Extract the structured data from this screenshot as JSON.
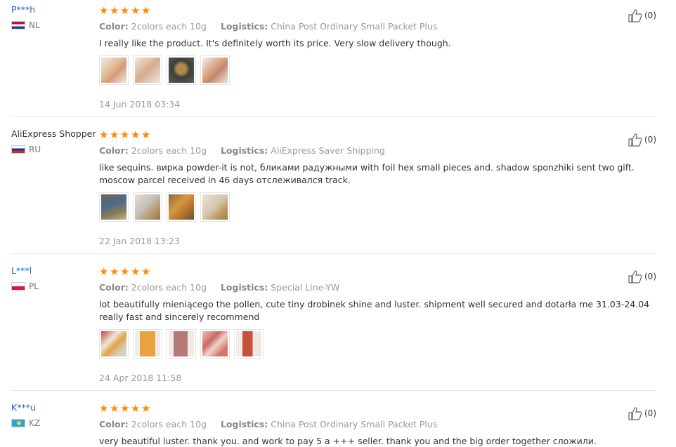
{
  "labels": {
    "color": "Color:",
    "logistics": "Logistics:"
  },
  "reviews": [
    {
      "user": "P***h",
      "country": "NL",
      "color": "2colors each 10g",
      "logistics": "China Post Ordinary Small Packet Plus",
      "text": "I really like the product. It's definitely worth its price. Very slow delivery though.",
      "date": "14 Jun 2018 03:34",
      "likes": "(0)",
      "rating": 5
    },
    {
      "user": "AliExpress Shopper",
      "country": "RU",
      "color": "2colors each 10g",
      "logistics": "AliExpress Saver Shipping",
      "text": "like sequins. вирка powder-it is not, бликами радужными with foil hex small pieces and. shadow sponzhiki sent two gift. moscow parcel received in 46 days отслеживался track.",
      "date": "22 Jan 2018 13:23",
      "likes": "(0)",
      "rating": 5
    },
    {
      "user": "L***l",
      "country": "PL",
      "color": "2colors each 10g",
      "logistics": "Special Line-YW",
      "text": "lot beautifully mieniącego the pollen, cute tiny drobinek shine and luster. shipment well secured and dotarła me 31.03-24.04 really fast and sincerely recommend",
      "date": "24 Apr 2018 11:58",
      "likes": "(0)",
      "rating": 5
    },
    {
      "user": "K***u",
      "country": "KZ",
      "color": "2colors each 10g",
      "logistics": "China Post Ordinary Small Packet Plus",
      "text": "very beautiful luster. thank you. and work to pay 5 a +++ seller. thank you and the big order together сложили.",
      "likes": "(0)",
      "rating": 5
    }
  ]
}
